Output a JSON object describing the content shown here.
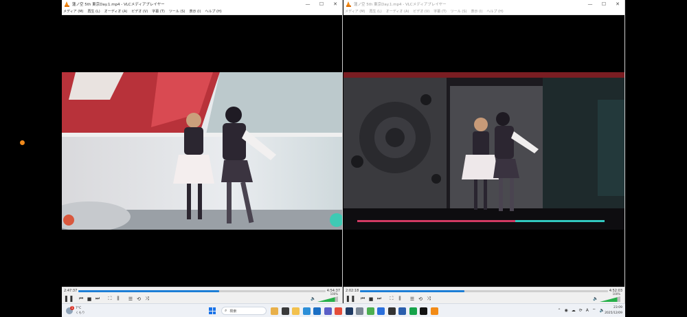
{
  "left_player": {
    "title": "蓮ノ空 5th 東京Day.1.mp4 - VLCメディアプレイヤー",
    "menu": [
      "メディア (M)",
      "再生 (L)",
      "オーディオ (A)",
      "ビデオ (V)",
      "字幕 (T)",
      "ツール (S)",
      "表示 (I)",
      "ヘルプ (H)"
    ],
    "current_time": "2:47:37",
    "total_time": "4:54:37",
    "progress_fraction": 0.57,
    "volume_label": "100%",
    "volume_fraction": 0.85
  },
  "right_player": {
    "title": "蓮ノ空 5th 東京Day.1.mp4 - VLCメディアプレイヤー",
    "menu": [
      "メディア (M)",
      "再生 (L)",
      "オーディオ (A)",
      "ビデオ (V)",
      "字幕 (T)",
      "ツール (S)",
      "表示 (I)",
      "ヘルプ (H)"
    ],
    "current_time": "2:02:18",
    "total_time": "4:52:03",
    "progress_fraction": 0.42,
    "volume_label": "100%",
    "volume_fraction": 0.85
  },
  "window_buttons": {
    "minimize": "—",
    "maximize": "☐",
    "close": "✕"
  },
  "control_glyphs": {
    "play_pause": "❚❚",
    "prev": "⏮",
    "stop": "■",
    "next": "⏭",
    "fullscreen": "⛶",
    "extended": "⫼",
    "playlist": "☰",
    "loop": "⟲",
    "random": "⤨",
    "volume": "🔈"
  },
  "taskbar": {
    "weather_temp": "7°C",
    "weather_desc": "くもり",
    "notification_count": "1",
    "search_placeholder": "検索",
    "time": "23:09",
    "date": "2025/12/09",
    "tray_language": "A"
  },
  "colors": {
    "accent": "#1d7ed6",
    "vlc_orange": "#f28b17",
    "volume_green": "#27b04a",
    "status_dot": "#f08a1c"
  }
}
